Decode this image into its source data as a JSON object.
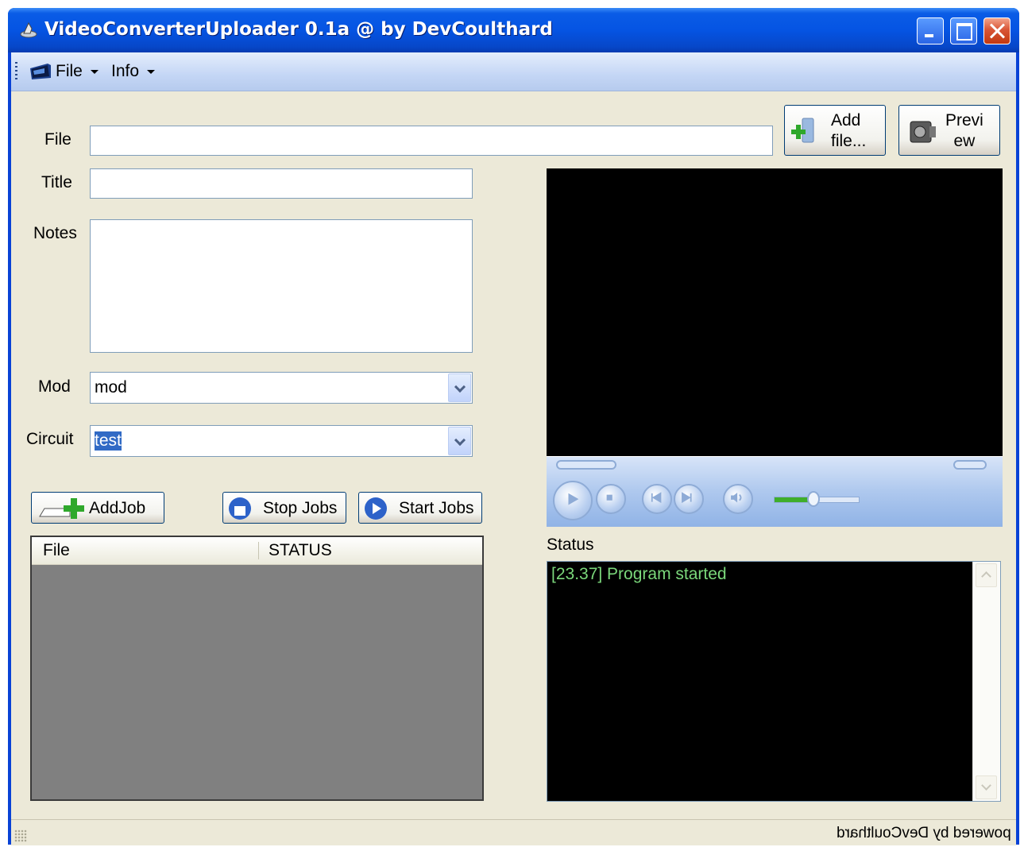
{
  "window": {
    "title": "VideoConverterUploader 0.1a @ by DevCoulthard"
  },
  "menu": {
    "items": [
      {
        "label": "File"
      },
      {
        "label": "Info"
      }
    ]
  },
  "form": {
    "file_label": "File",
    "file_value": "",
    "title_label": "Title",
    "title_value": "",
    "notes_label": "Notes",
    "notes_value": "",
    "mod_label": "Mod",
    "mod_value": "mod",
    "circuit_label": "Circuit",
    "circuit_value": "test"
  },
  "buttons": {
    "add_file": "Add\nfile...",
    "preview": "Previ\new",
    "add_job": "AddJob",
    "stop_jobs": "Stop Jobs",
    "start_jobs": "Start Jobs"
  },
  "jobs_table": {
    "columns": [
      "File",
      "STATUS"
    ],
    "rows": []
  },
  "status": {
    "label": "Status",
    "lines": [
      "[23.37] Program started"
    ],
    "text_color": "#7bd87b"
  },
  "footer": {
    "powered_by": "powered by DevCoulthard"
  },
  "colors": {
    "titlebar": "#0554e3",
    "client": "#ece9d8",
    "video_bg": "#000000",
    "jobs_bg": "#808080"
  },
  "icons": [
    "app-icon",
    "minimize-icon",
    "maximize-icon",
    "close-icon",
    "file-menu-icon",
    "add-file-icon",
    "preview-camera-icon",
    "add-job-icon",
    "stop-icon",
    "start-icon",
    "play-icon",
    "stop-playback-icon",
    "previous-icon",
    "next-icon",
    "mute-icon"
  ]
}
